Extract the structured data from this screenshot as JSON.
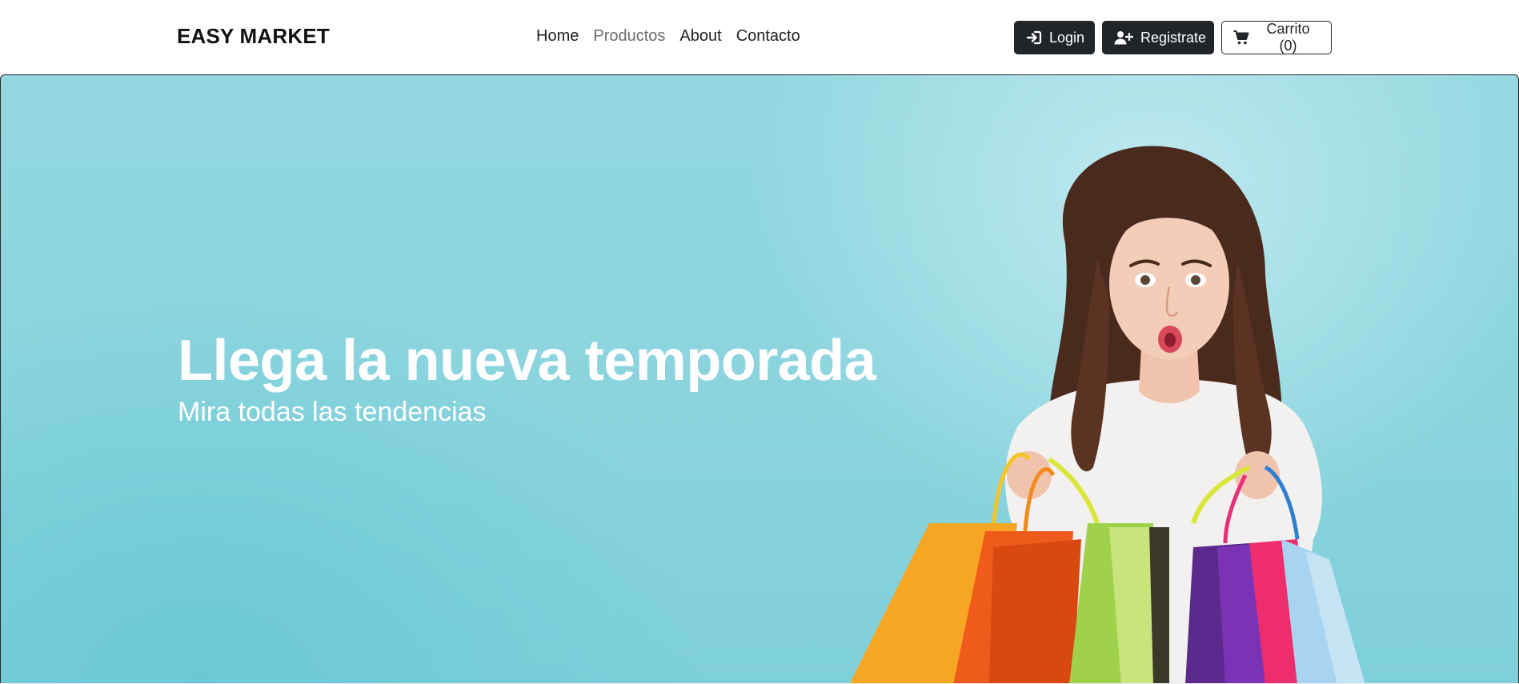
{
  "navbar": {
    "brand": "EASY MARKET",
    "links": [
      {
        "label": "Home",
        "active": false
      },
      {
        "label": "Productos",
        "active": true
      },
      {
        "label": "About",
        "active": false
      },
      {
        "label": "Contacto",
        "active": false
      }
    ],
    "actions": {
      "login_label": "Login",
      "login_icon": "sign-in-icon",
      "register_label": "Registrate",
      "register_icon": "user-plus-icon",
      "cart_label": "Carrito (0)",
      "cart_icon": "cart-icon"
    }
  },
  "hero": {
    "title": "Llega la nueva temporada",
    "subtitle": "Mira todas las tendencias",
    "image_subject": "woman-holding-shopping-bags"
  },
  "colors": {
    "hero_background": "#8ad4de",
    "button_dark": "#212529",
    "text_white": "#ffffff",
    "nav_active": "#6c6c6c"
  }
}
